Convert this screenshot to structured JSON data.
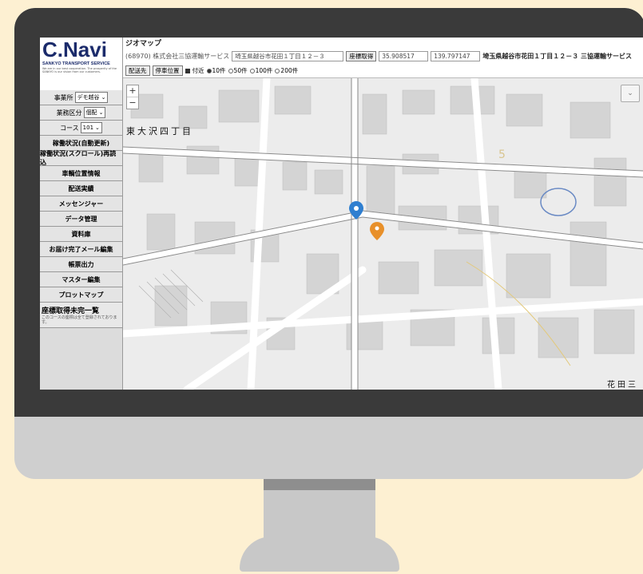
{
  "app": {
    "logo_text": "C.",
    "logo_text2": "Navi",
    "logo_subtitle": "SANKYO TRANSPORT SERVICE",
    "logo_note": "We are in our best cooperation. The prosperity of the SANKYO is our vision from our customers."
  },
  "sidebar": {
    "office_label": "事業所",
    "office_value": "デモ越谷",
    "category_label": "業務区分",
    "category_value": "個配",
    "course_label": "コース",
    "course_value": "101",
    "items": [
      "稼働状況(自動更新)",
      "稼働状況(スクロール)再読込",
      "車輌位置情報",
      "配送実績",
      "メッセンジャー",
      "データ管理",
      "資料庫",
      "お届け完了メール編集",
      "帳票出力",
      "マスター編集",
      "プロットマップ"
    ],
    "pending_title": "座標取得未完一覧",
    "pending_note": "このコースの座標は全て登録されております。"
  },
  "header": {
    "title": "ジオマップ",
    "company": "(68970) 株式会社三協運輸サービス",
    "address_input": "埼玉県越谷市花田１丁目１２－３",
    "get_coords_label": "座標取得",
    "lat": "35.908517",
    "lng": "139.797147",
    "address_display": "埼玉県越谷市花田１丁目１２－３ 三協運輸サービス",
    "dest_button": "配送先",
    "stop_button": "停車位置",
    "nearby_label": "付近",
    "radio_options": [
      "10件",
      "50件",
      "100件",
      "200件"
    ],
    "radio_selected": 0
  },
  "map": {
    "zoom_in": "+",
    "zoom_out": "−",
    "area_label": "東大沢四丁目",
    "block_number": "5",
    "bottom_label": "花田三"
  },
  "colors": {
    "background": "#fdf0d2",
    "bezel": "#3a3a3a",
    "brand": "#1b2b6b",
    "marker_vehicle": "#2f7fd0",
    "marker_person": "#e8902a"
  }
}
